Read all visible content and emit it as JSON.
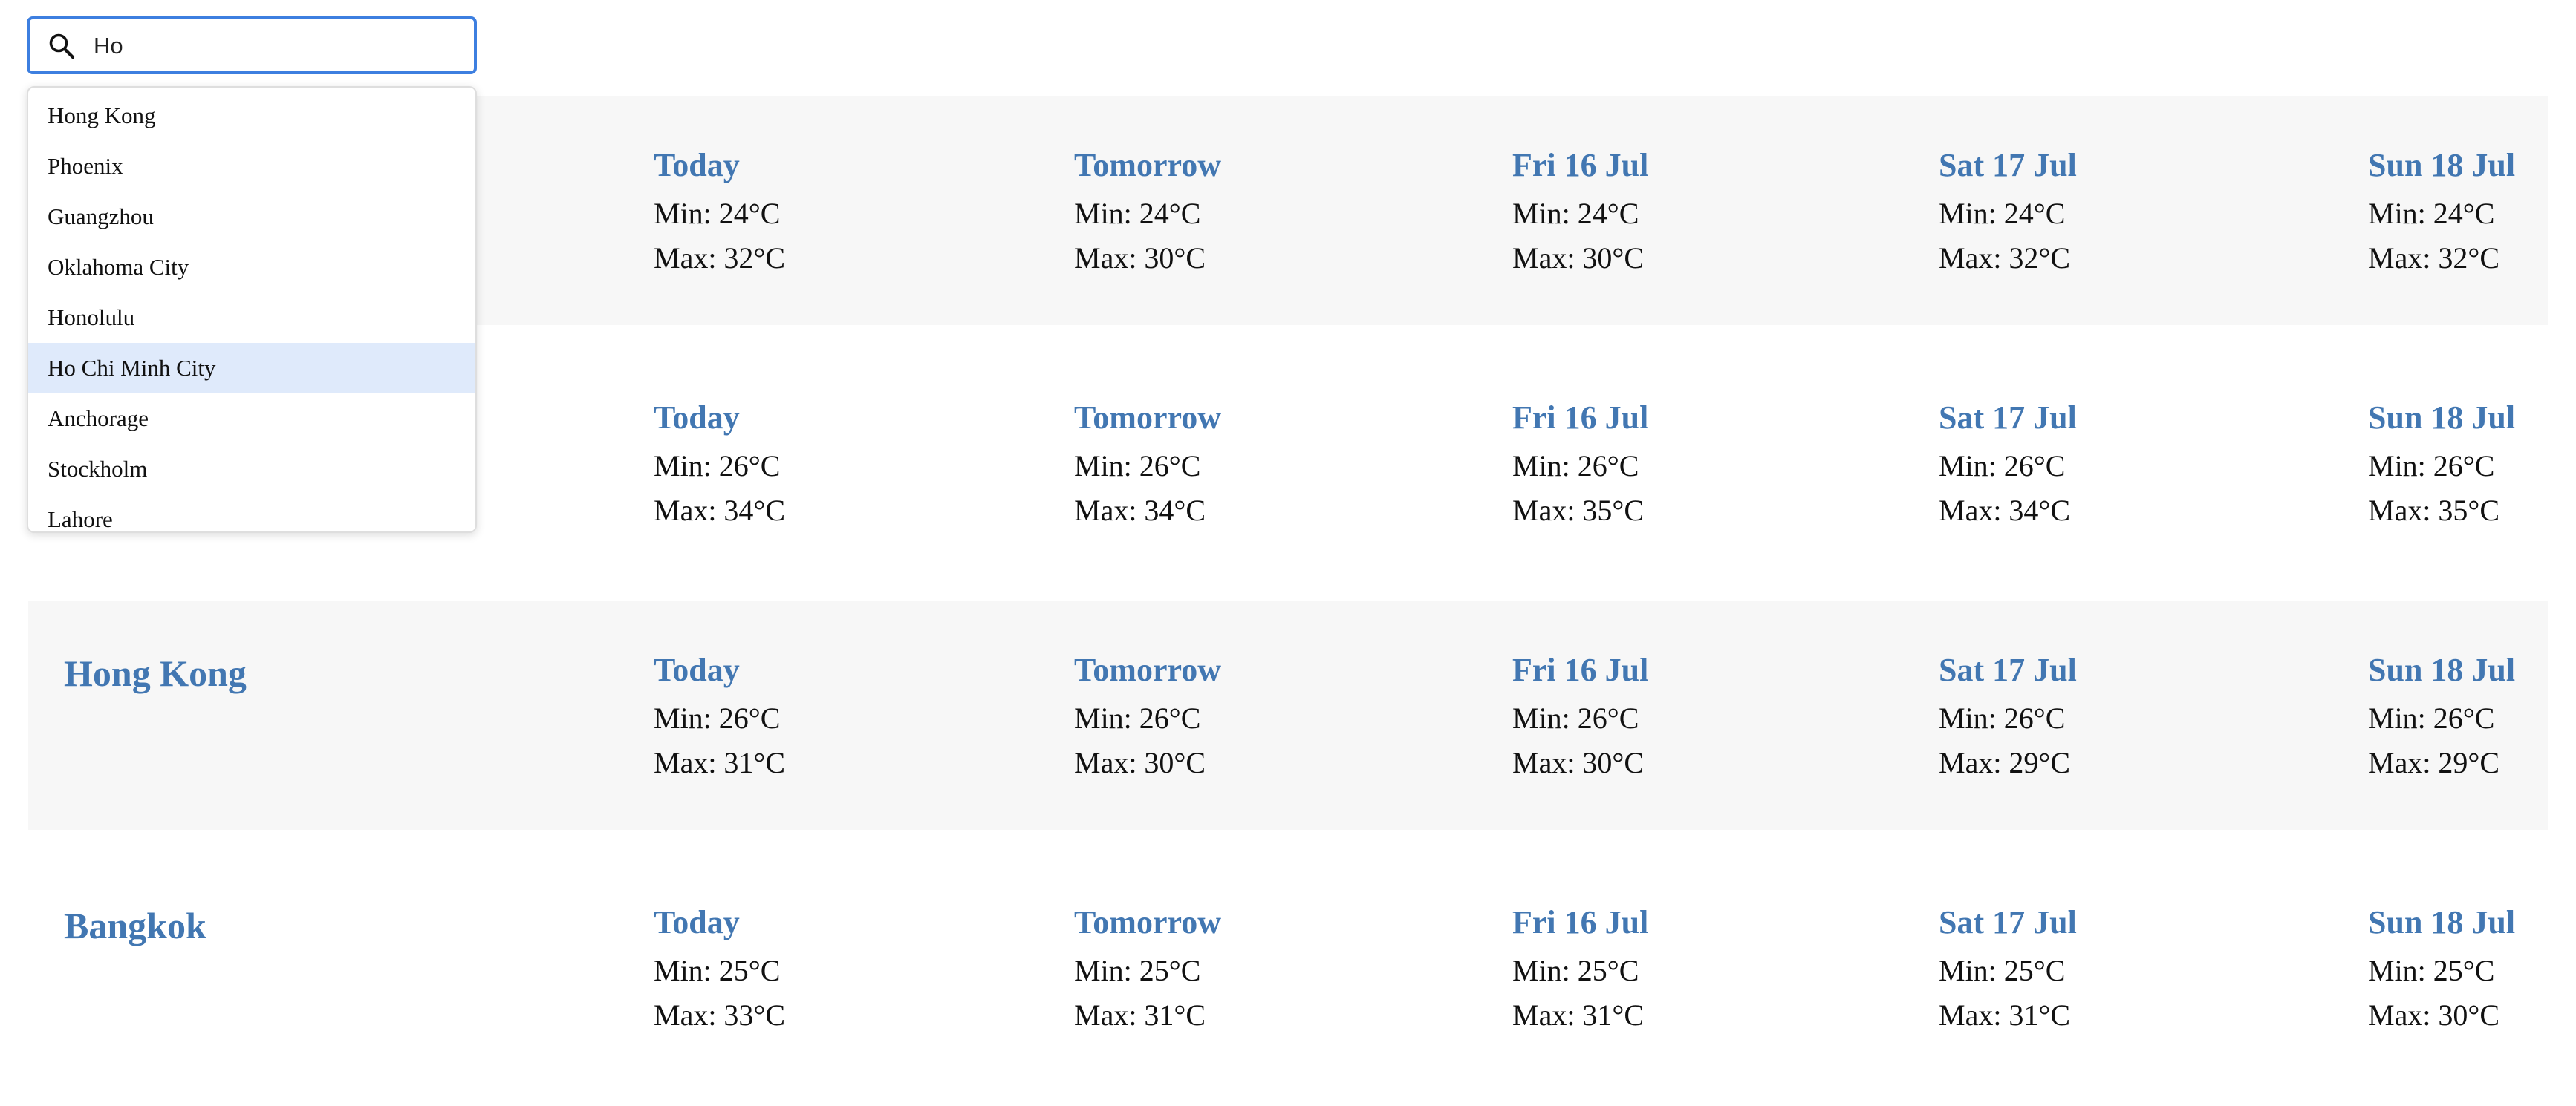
{
  "search": {
    "value": "Ho",
    "suggestions": [
      "Hong Kong",
      "Phoenix",
      "Guangzhou",
      "Oklahoma City",
      "Honolulu",
      "Ho Chi Minh City",
      "Anchorage",
      "Stockholm",
      "Lahore"
    ],
    "highlighted": "Ho Chi Minh City"
  },
  "days": [
    "Today",
    "Tomorrow",
    "Fri 16 Jul",
    "Sat 17 Jul",
    "Sun 18 Jul"
  ],
  "cities": [
    {
      "name": "",
      "forecast": [
        {
          "min": "Min: 24°C",
          "max": "Max: 32°C"
        },
        {
          "min": "Min: 24°C",
          "max": "Max: 30°C"
        },
        {
          "min": "Min: 24°C",
          "max": "Max: 30°C"
        },
        {
          "min": "Min: 24°C",
          "max": "Max: 32°C"
        },
        {
          "min": "Min: 24°C",
          "max": "Max: 32°C"
        }
      ]
    },
    {
      "name": "",
      "forecast": [
        {
          "min": "Min: 26°C",
          "max": "Max: 34°C"
        },
        {
          "min": "Min: 26°C",
          "max": "Max: 34°C"
        },
        {
          "min": "Min: 26°C",
          "max": "Max: 35°C"
        },
        {
          "min": "Min: 26°C",
          "max": "Max: 34°C"
        },
        {
          "min": "Min: 26°C",
          "max": "Max: 35°C"
        }
      ]
    },
    {
      "name": "Hong Kong",
      "forecast": [
        {
          "min": "Min: 26°C",
          "max": "Max: 31°C"
        },
        {
          "min": "Min: 26°C",
          "max": "Max: 30°C"
        },
        {
          "min": "Min: 26°C",
          "max": "Max: 30°C"
        },
        {
          "min": "Min: 26°C",
          "max": "Max: 29°C"
        },
        {
          "min": "Min: 26°C",
          "max": "Max: 29°C"
        }
      ]
    },
    {
      "name": "Bangkok",
      "forecast": [
        {
          "min": "Min: 25°C",
          "max": "Max: 33°C"
        },
        {
          "min": "Min: 25°C",
          "max": "Max: 31°C"
        },
        {
          "min": "Min: 25°C",
          "max": "Max: 31°C"
        },
        {
          "min": "Min: 25°C",
          "max": "Max: 31°C"
        },
        {
          "min": "Min: 25°C",
          "max": "Max: 30°C"
        }
      ]
    }
  ],
  "colors": {
    "accent": "#4277b2",
    "focus_border": "#3d7fe0",
    "row_alt_bg": "#f7f7f7",
    "highlight_bg": "#dfeafb"
  },
  "icons": {
    "search": "search-icon"
  }
}
